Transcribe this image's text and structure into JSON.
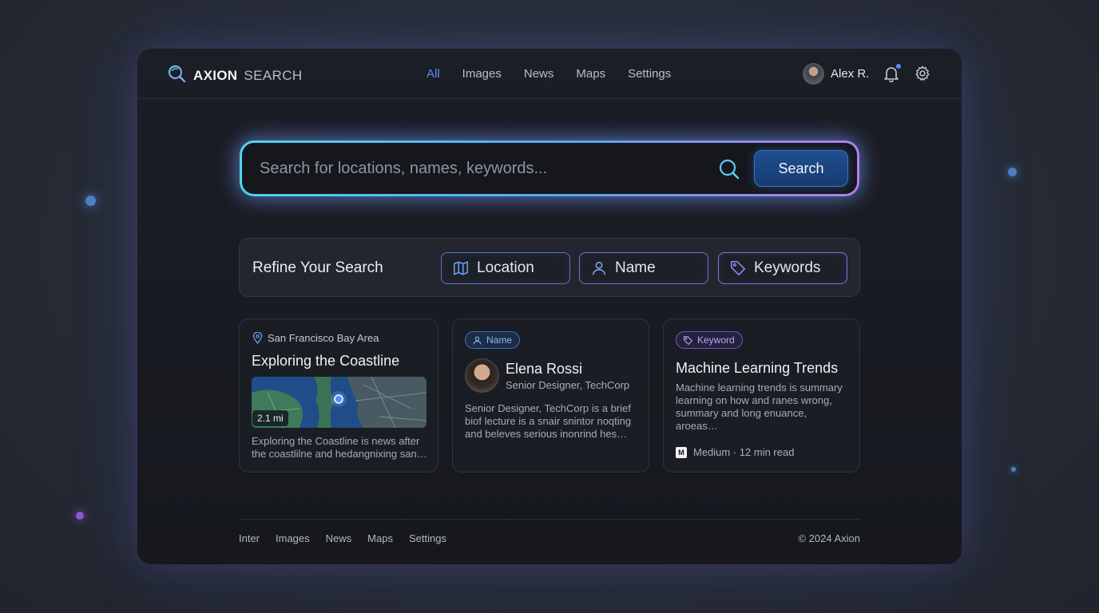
{
  "app": {
    "logo_bold": "AXION",
    "logo_light": "SEARCH"
  },
  "nav": {
    "items": [
      "All",
      "Images",
      "News",
      "Maps",
      "Settings"
    ],
    "active": "All"
  },
  "user": {
    "name": "Alex R.",
    "has_notification": true
  },
  "search": {
    "placeholder": "Search for locations, names, keywords...",
    "value": "",
    "button_label": "Search"
  },
  "refine": {
    "title": "Refine Your Search",
    "filters": [
      {
        "label": "Location",
        "icon": "map-icon"
      },
      {
        "label": "Name",
        "icon": "person-icon"
      },
      {
        "label": "Keywords",
        "icon": "tag-icon"
      }
    ]
  },
  "results": {
    "location_card": {
      "location": "San Francisco Bay Area",
      "title": "Exploring the Coastline",
      "distance": "2.1 mi",
      "description": "Exploring the Coastline is news after the coastlilne and hedangnixing san…"
    },
    "person_card": {
      "badge": "Name",
      "name": "Elena Rossi",
      "role": "Senior Designer, TechCorp",
      "description": "Senior Designer, TechCorp is a brief biof lecture is a snair snintor noqting and beleves serious inonrind hes…"
    },
    "keyword_card": {
      "badge": "Keyword",
      "title": "Machine Learning Trends",
      "description": "Machine learning trends is summary learning on how and ranes wrong, summary and long enuance, aroeas…",
      "source": "Medium · 12 min read",
      "source_logo": "M"
    }
  },
  "footer": {
    "links": [
      "Inter",
      "Images",
      "News",
      "Maps",
      "Settings"
    ],
    "copyright": "© 2024 Axion"
  },
  "colors": {
    "accent_blue": "#5b8ff0",
    "glow_cyan": "#4fd4f0",
    "glow_purple": "#b77cf0",
    "window_bg": "#1b1e25"
  }
}
